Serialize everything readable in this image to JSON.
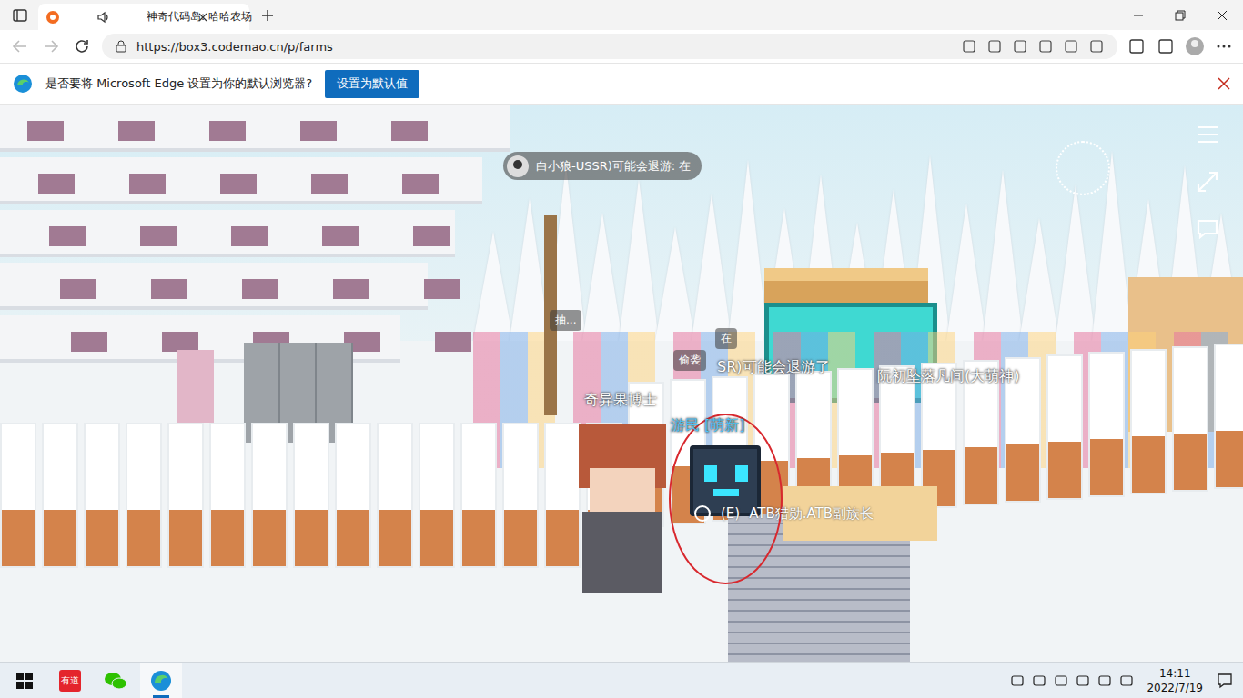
{
  "browser": {
    "tab": {
      "title": "神奇代码岛: 哈哈农场",
      "selected": true
    },
    "url": "https://box3.codemao.cn/p/farms",
    "prompt": {
      "text": "是否要将 Microsoft Edge 设置为你的默认浏览器?",
      "button": "设置为默认值"
    }
  },
  "game": {
    "toast": {
      "text": "白小狼-USSR)可能会退游: 在"
    },
    "bubbles": [
      "抽...",
      "在",
      "偷袭"
    ],
    "nametags": [
      {
        "text": "SR)可能会退游了",
        "color": "#ffffff"
      },
      {
        "text": "奇异果博士",
        "color": "#ffffff"
      },
      {
        "text": "阮初坠落凡间(大萌神)",
        "color": "#ffffff"
      },
      {
        "text": "游民 [萌新]",
        "color": "#4fc3f7"
      }
    ],
    "interact": {
      "key": "(E)",
      "label": "ATB猎勋.ATB副族长"
    }
  },
  "taskbar": {
    "apps": [
      {
        "kind": "youdao",
        "label": "有道",
        "selected": false
      },
      {
        "kind": "wechat",
        "selected": false
      },
      {
        "kind": "edge",
        "selected": true
      }
    ],
    "time": "14:11",
    "date": "2022/7/19"
  }
}
